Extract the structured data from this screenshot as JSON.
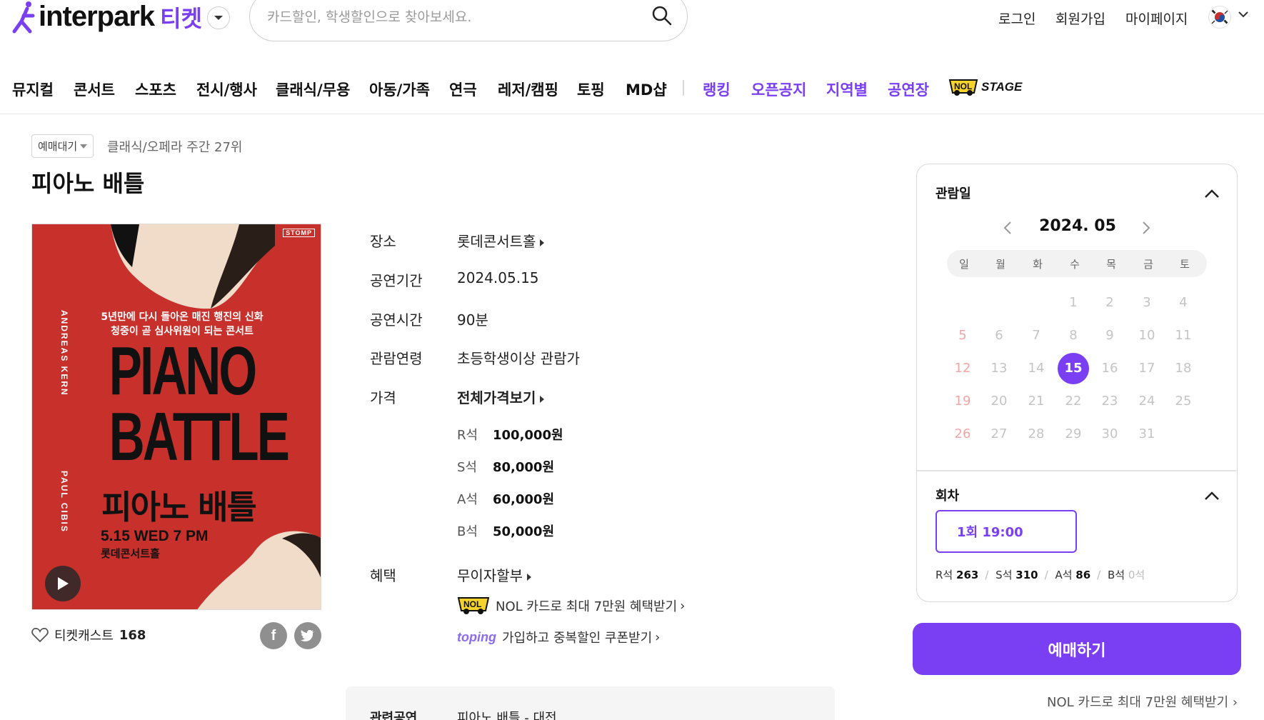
{
  "header": {
    "logo_text": "interpark",
    "logo_ticket": "티켓",
    "search_placeholder": "카드할인, 학생할인으로 찾아보세요.",
    "links": [
      "로그인",
      "회원가입",
      "마이페이지"
    ]
  },
  "nav": {
    "categories": [
      "뮤지컬",
      "콘서트",
      "스포츠",
      "전시/행사",
      "클래식/무용",
      "아동/가족",
      "연극",
      "레저/캠핑",
      "토핑",
      "MD샵"
    ],
    "highlights": [
      "랭킹",
      "오픈공지",
      "지역별",
      "공연장"
    ],
    "nol_stage": "STAGE"
  },
  "product": {
    "badge": "예매대기",
    "rank": "클래식/오페라 주간 27위",
    "title": "피아노 배틀",
    "poster": {
      "subtitle_1": "5년만에 다시 돌아온 매진 행진의 신화",
      "subtitle_2": "청중이 곧 심사위원이 되는 콘서트",
      "title_en": "PIANO BATTLE",
      "title_ko": "피아노 배틀",
      "date": "5.15 WED 7 PM",
      "venue": "롯데콘서트홀",
      "name_1": "ANDREAS KERN",
      "name_2": "PAUL CIBIS",
      "tag": "STOMP"
    },
    "ticketcast_label": "티켓캐스트",
    "ticketcast_count": "168"
  },
  "info": {
    "venue_label": "장소",
    "venue": "롯데콘서트홀",
    "period_label": "공연기간",
    "period": "2024.05.15",
    "runtime_label": "공연시간",
    "runtime": "90분",
    "age_label": "관람연령",
    "age": "초등학생이상 관람가",
    "price_label": "가격",
    "price_all": "전체가격보기",
    "prices": [
      {
        "seat": "R석",
        "amount": "100,000원"
      },
      {
        "seat": "S석",
        "amount": "80,000원"
      },
      {
        "seat": "A석",
        "amount": "60,000원"
      },
      {
        "seat": "B석",
        "amount": "50,000원"
      }
    ],
    "benefit_label": "혜택",
    "benefit_main": "무이자할부",
    "benefit_nol": "NOL 카드로 최대 7만원 혜택받기",
    "toping_logo": "toping",
    "benefit_toping": "가입하고 중복할인 쿠폰받기",
    "related_label": "관련공연",
    "related_value": "피아노 배틀 - 대전"
  },
  "calendar": {
    "title": "관람일",
    "month": "2024. 05",
    "weekdays": [
      "일",
      "월",
      "화",
      "수",
      "목",
      "금",
      "토"
    ],
    "first_weekday": 3,
    "days_in_month": 31,
    "selected_day": 15,
    "session_title": "회차",
    "session": "1회 19:00",
    "seats": [
      {
        "grade": "R석",
        "count": "263"
      },
      {
        "grade": "S석",
        "count": "310"
      },
      {
        "grade": "A석",
        "count": "86"
      },
      {
        "grade": "B석",
        "count": "0석"
      }
    ]
  },
  "booking": {
    "button": "예매하기",
    "nol_card": "NOL 카드로 최대 7만원 혜택받기"
  },
  "colors": {
    "accent": "#7a3ff2",
    "poster_red": "#c8312b"
  }
}
